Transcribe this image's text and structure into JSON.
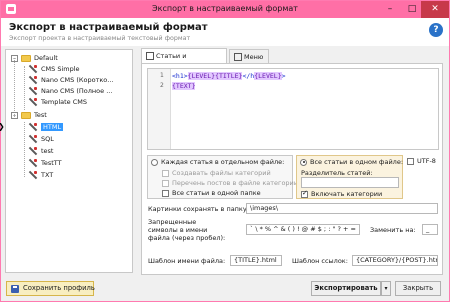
{
  "window": {
    "title": "Экспорт в настраиваемый формат",
    "minimize": "–",
    "maximize": "□",
    "close": "✕"
  },
  "header": {
    "title": "Экспорт в настраиваемый формат",
    "subtitle": "Экспорт проекта в настраиваемый текстовый формат",
    "help": "?"
  },
  "tree": {
    "folders": [
      "Default",
      "Test"
    ],
    "default_items": [
      "CMS Simple",
      "Nano CMS (Коротко...",
      "Nano CMS (Полное ...",
      "Template CMS"
    ],
    "test_items": [
      "HTML",
      "SQL",
      "test",
      "TestTT",
      "TXT"
    ],
    "selected": "HTML",
    "expand_sign": "–",
    "arrow": "❯"
  },
  "tabs": [
    "Статьи и категории",
    "Меню"
  ],
  "editor": {
    "line_numbers": [
      "1",
      "2"
    ],
    "line1": [
      {
        "t": "<h1>",
        "k": "tag"
      },
      {
        "t": "{LEVEL}",
        "k": "var"
      },
      {
        "t": "{TITLE}",
        "k": "var"
      },
      {
        "t": "</h",
        "k": "tag"
      },
      {
        "t": "{LEVEL}",
        "k": "var"
      },
      {
        "t": ">",
        "k": "tag"
      }
    ],
    "line2": [
      {
        "t": "{TEXT}",
        "k": "var"
      }
    ]
  },
  "options": {
    "each_file_label": "Каждая статья в отдельном файле:",
    "create_category_files": "Создавать файлы категорий",
    "post_list_label": "Перечень постов в файле категории",
    "all_in_one_folder": "Все статьи в одной папке",
    "all_in_one_file_label": "Все статьи в одном файле:",
    "separator_label": "Разделитель статей:",
    "include_categories": "Включать категории",
    "utf8_label": "UTF-8"
  },
  "fields": {
    "images_label": "Картинки сохранять в папку:",
    "images_value": "\\images\\",
    "forbidden_label_1": "Запрещенные",
    "forbidden_label_2": "символы в имени",
    "forbidden_label_3": "файла (через пробел):",
    "forbidden_value": "` \\ * % ^ & ( ) ! @ # $ ; : \" ? + =",
    "replace_label": "Заменить на:",
    "replace_value": "_",
    "filename_template_label": "Шаблон имени файла:",
    "filename_template_value": "{TITLE}.html",
    "link_template_label": "Шаблон ссылок:",
    "link_template_value": "{CATEGORY}/{POST}.html"
  },
  "footer": {
    "save_profile": "Сохранить профиль",
    "export": "Экспортировать",
    "export_drop": "▾",
    "close": "Закрыть"
  }
}
